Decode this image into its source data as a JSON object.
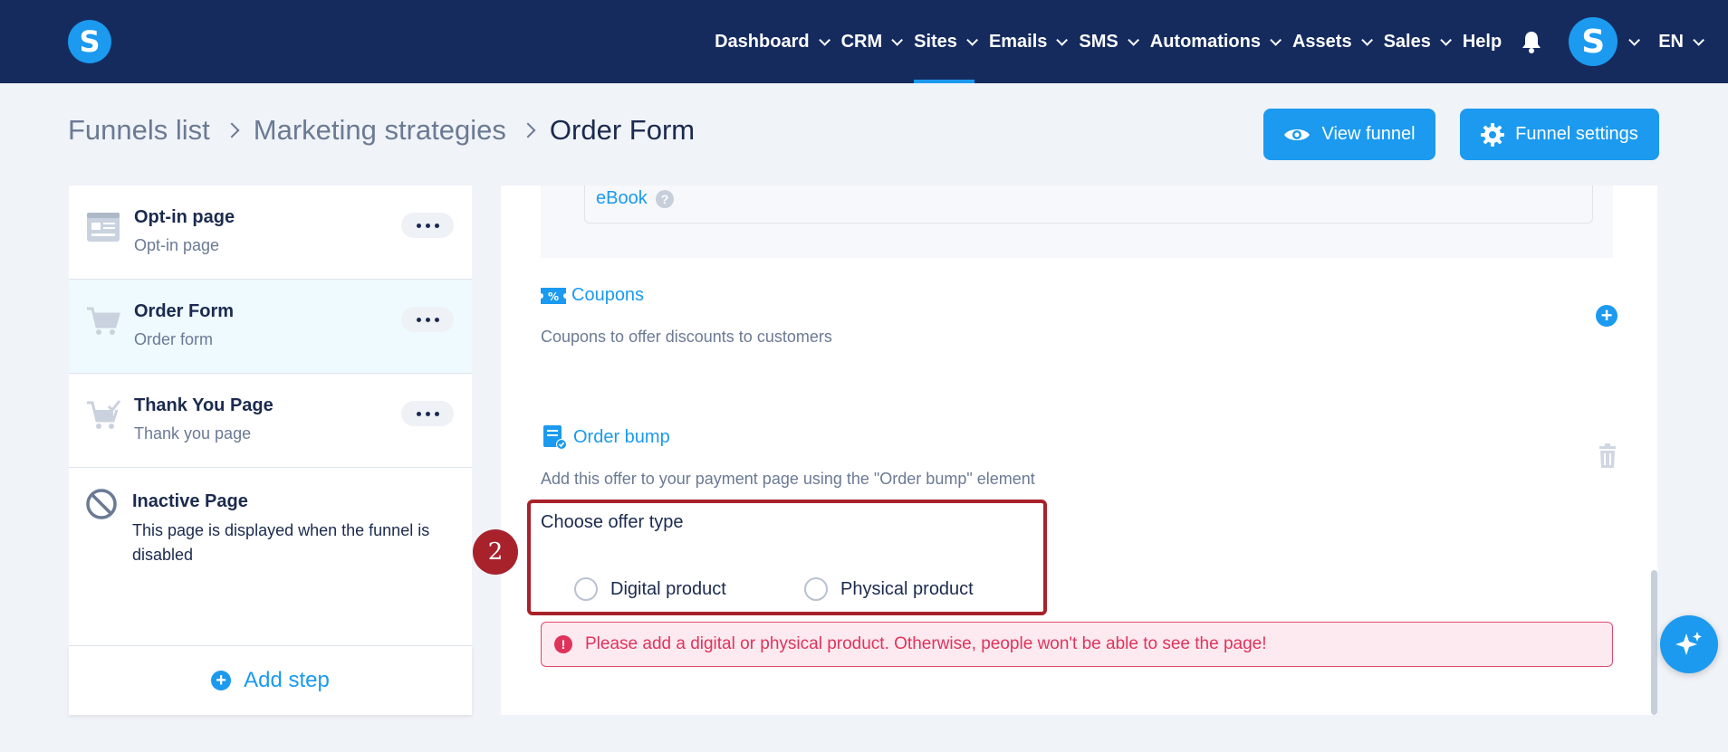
{
  "nav": {
    "logo": "S",
    "items": [
      {
        "label": "Dashboard",
        "dropdown": true,
        "active": false
      },
      {
        "label": "CRM",
        "dropdown": true,
        "active": false
      },
      {
        "label": "Sites",
        "dropdown": true,
        "active": true
      },
      {
        "label": "Emails",
        "dropdown": true,
        "active": false
      },
      {
        "label": "SMS",
        "dropdown": true,
        "active": false
      },
      {
        "label": "Automations",
        "dropdown": true,
        "active": false
      },
      {
        "label": "Assets",
        "dropdown": true,
        "active": false
      },
      {
        "label": "Sales",
        "dropdown": true,
        "active": false
      },
      {
        "label": "Help",
        "dropdown": false,
        "active": false
      }
    ],
    "avatar_letter": "S",
    "language": "EN"
  },
  "breadcrumb": {
    "items": [
      "Funnels list",
      "Marketing strategies"
    ],
    "current": "Order Form"
  },
  "actions": {
    "view_funnel": "View funnel",
    "funnel_settings": "Funnel settings"
  },
  "steps": [
    {
      "title": "Opt-in page",
      "subtitle": "Opt-in page",
      "icon": "optin-page-icon"
    },
    {
      "title": "Order Form",
      "subtitle": "Order form",
      "icon": "cart-icon"
    },
    {
      "title": "Thank You Page",
      "subtitle": "Thank you page",
      "icon": "cart-check-icon"
    }
  ],
  "inactive": {
    "title": "Inactive Page",
    "subtitle": "This page is displayed when the funnel is disabled"
  },
  "add_step": "Add step",
  "content": {
    "ebook_label": "eBook",
    "coupons": {
      "title": "Coupons",
      "description": "Coupons to offer discounts to customers"
    },
    "order_bump": {
      "title": "Order bump",
      "description": "Add this offer to your payment page using the \"Order bump\" element"
    },
    "offer_type": {
      "label": "Choose offer type",
      "options": [
        "Digital product",
        "Physical product"
      ]
    },
    "step_badge": "2",
    "alert": "Please add a digital or physical product. Otherwise, people won't be able to see the page!"
  },
  "colors": {
    "nav_bg": "#152b5e",
    "accent": "#1b9aef",
    "highlight": "#a8222b",
    "error": "#e0335c"
  }
}
